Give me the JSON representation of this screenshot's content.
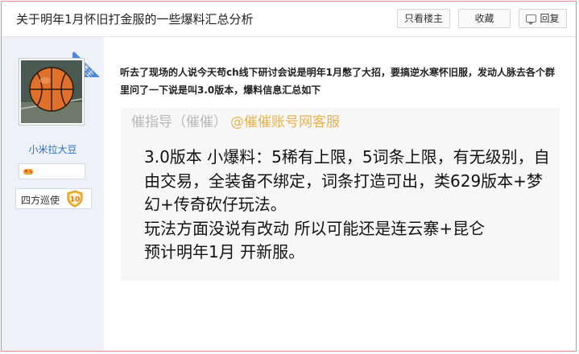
{
  "thread": {
    "title": "关于明年1月怀旧打金服的一些爆料汇总分析",
    "buttons": {
      "only_author": "只看楼主",
      "favorite": "收藏",
      "reply": "回复"
    }
  },
  "author": {
    "host_tag": "楼主",
    "username": "小米拉大豆",
    "level_title": "四方巡使",
    "level_number": "10"
  },
  "post": {
    "intro": "听去了现场的人说今天苟ch线下研讨会说是明年1月憋了大招，要搞逆水寒怀旧服，发动人脉去各个群里问了一下说是叫3.0版本，爆料信息汇总如下",
    "image": {
      "header_left": "催指导（催催）",
      "header_account": "@催催账号网客服",
      "line1": "3.0版本 小爆料：5稀有上限，5词条上限，有无级别，自由交易，全装备不绑定，词条打造可出，类629版本+梦幻+传奇砍仔玩法。",
      "line2": "玩法方面没说有改动 所以可能还是连云寨+昆仑",
      "line3": "预计明年1月 开新服。"
    }
  },
  "colors": {
    "border_accent": "#e4898a",
    "sidebar_bg": "#eef2f8",
    "host_tag": "#4e86d6",
    "username": "#2a6fc9",
    "level_badge": "#f2b630"
  }
}
